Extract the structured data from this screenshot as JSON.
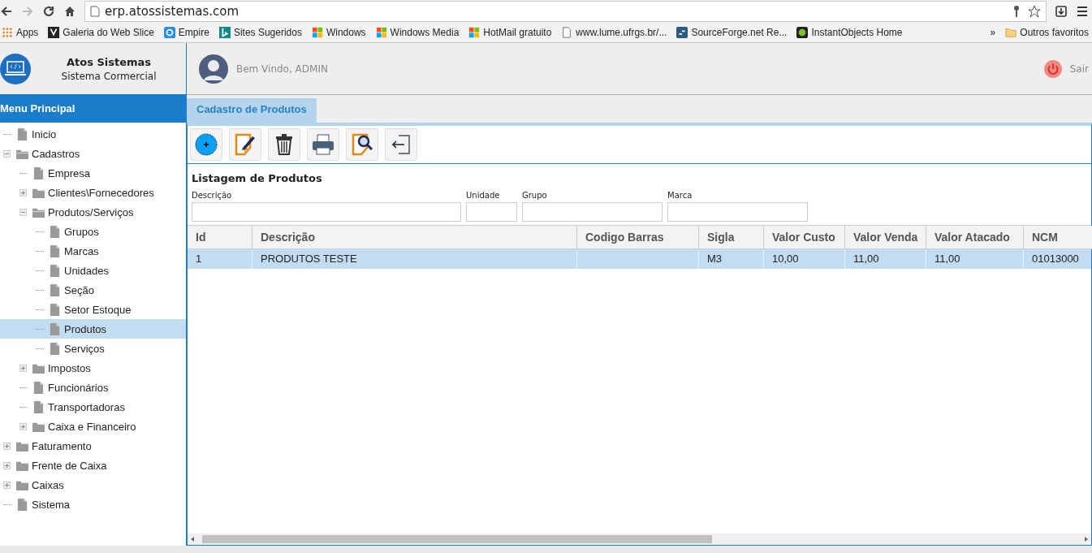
{
  "browser": {
    "url": "erp.atossistemas.com",
    "bookmarks": [
      {
        "kind": "apps",
        "label": "Apps"
      },
      {
        "kind": "slice",
        "label": "Galeria do Web Slice"
      },
      {
        "kind": "empire",
        "label": "Empire"
      },
      {
        "kind": "bing",
        "label": "Sites Sugeridos"
      },
      {
        "kind": "windows",
        "label": "Windows"
      },
      {
        "kind": "windows",
        "label": "Windows Media"
      },
      {
        "kind": "windows",
        "label": "HotMail gratuito"
      },
      {
        "kind": "page",
        "label": "www.lume.ufrgs.br/..."
      },
      {
        "kind": "sf",
        "label": "SourceForge.net Re..."
      },
      {
        "kind": "dot",
        "label": "InstantObjects Home"
      }
    ],
    "more": "»",
    "other_bookmarks": "Outros favoritos"
  },
  "brand": {
    "title": "Atos Sistemas",
    "subtitle": "Sistema Cormercial"
  },
  "user": {
    "greeting": "Bem Vindo, ADMIN",
    "logout": "Sair"
  },
  "menu": {
    "title": "Menu Principal",
    "tree": [
      {
        "kind": "page",
        "label": "Inicio",
        "selected": false
      },
      {
        "kind": "folder",
        "label": "Cadastros",
        "expanded": true,
        "selected": false,
        "children": [
          {
            "kind": "page",
            "label": "Empresa",
            "selected": false
          },
          {
            "kind": "folder",
            "label": "Clientes\\Fornecedores",
            "expanded": false,
            "selected": false
          },
          {
            "kind": "folder",
            "label": "Produtos/Serviços",
            "expanded": true,
            "selected": false,
            "children": [
              {
                "kind": "page",
                "label": "Grupos",
                "selected": false
              },
              {
                "kind": "page",
                "label": "Marcas",
                "selected": false
              },
              {
                "kind": "page",
                "label": "Unidades",
                "selected": false
              },
              {
                "kind": "page",
                "label": "Seção",
                "selected": false
              },
              {
                "kind": "page",
                "label": "Setor Estoque",
                "selected": false
              },
              {
                "kind": "page",
                "label": "Produtos",
                "selected": true
              },
              {
                "kind": "page",
                "label": "Serviços",
                "selected": false
              }
            ]
          },
          {
            "kind": "folder",
            "label": "Impostos",
            "expanded": false,
            "selected": false
          },
          {
            "kind": "page",
            "label": "Funcionários",
            "selected": false
          },
          {
            "kind": "page",
            "label": "Transportadoras",
            "selected": false
          },
          {
            "kind": "folder",
            "label": "Caixa e Financeiro",
            "expanded": false,
            "selected": false
          }
        ]
      },
      {
        "kind": "folder",
        "label": "Faturamento",
        "expanded": false,
        "selected": false
      },
      {
        "kind": "folder",
        "label": "Frente de Caixa",
        "expanded": false,
        "selected": false
      },
      {
        "kind": "folder",
        "label": "Caixas",
        "expanded": false,
        "selected": false
      },
      {
        "kind": "page",
        "label": "Sistema",
        "selected": false
      }
    ]
  },
  "tabs": [
    {
      "label": "Cadastro de Produtos",
      "selected": true
    }
  ],
  "toolbar": [
    {
      "kind": "add"
    },
    {
      "kind": "edit"
    },
    {
      "kind": "delete"
    },
    {
      "kind": "print"
    },
    {
      "kind": "search"
    },
    {
      "kind": "exit"
    }
  ],
  "listing": {
    "title": "Listagem de Produtos",
    "filters": [
      {
        "label": "Descrição"
      },
      {
        "label": "Unidade"
      },
      {
        "label": "Grupo"
      },
      {
        "label": "Marca"
      }
    ],
    "columns": [
      "Id",
      "Descrição",
      "Codigo Barras",
      "Sigla",
      "Valor Custo",
      "Valor Venda",
      "Valor Atacado",
      "NCM"
    ],
    "rows": [
      {
        "selected": true,
        "cells": [
          "1",
          "PRODUTOS TESTE",
          "",
          "M3",
          "10,00",
          "11,00",
          "11,00",
          "01013000"
        ]
      }
    ]
  }
}
